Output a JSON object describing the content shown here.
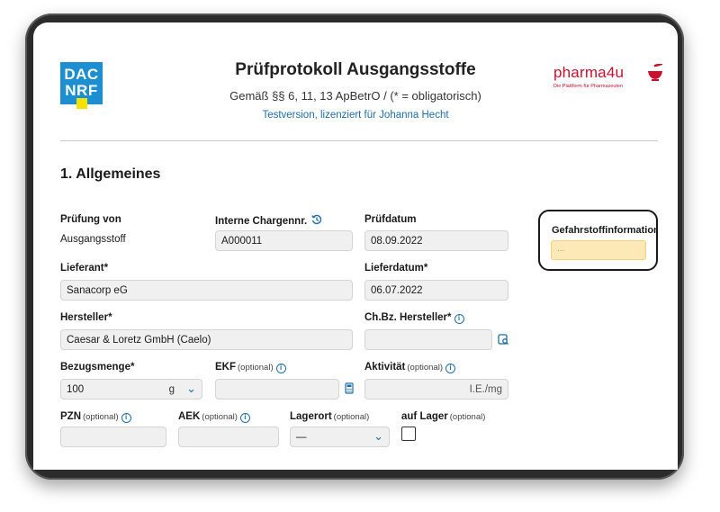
{
  "header": {
    "logo_left_line1": "DAC",
    "logo_left_line2": "NRF",
    "title": "Prüfprotokoll Ausgangsstoffe",
    "subtitle": "Gemäß §§ 6, 11, 13 ApBetrO / (* = obligatorisch)",
    "license": "Testversion, lizenziert für Johanna Hecht",
    "logo_right": "pharma4u",
    "logo_right_tagline": "Die Plattform für Pharmazeuten"
  },
  "section": {
    "title": "1. Allgemeines"
  },
  "form": {
    "pruefung_von": {
      "label": "Prüfung von",
      "value": "Ausgangsstoff"
    },
    "chargennr": {
      "label": "Interne Chargennr.",
      "value": "A000011",
      "icon": "history-icon"
    },
    "pruefdatum": {
      "label": "Prüfdatum",
      "value": "08.09.2022"
    },
    "lieferant": {
      "label": "Lieferant",
      "mark": "*",
      "value": "Sanacorp eG"
    },
    "lieferdatum": {
      "label": "Lieferdatum",
      "mark": "*",
      "value": "06.07.2022"
    },
    "hersteller": {
      "label": "Hersteller",
      "mark": "*",
      "value": "Caesar & Loretz GmbH (Caelo)"
    },
    "chbz_hersteller": {
      "label": "Ch.Bz. Hersteller",
      "mark": "*",
      "value": ""
    },
    "bezugsmenge": {
      "label": "Bezugsmenge",
      "mark": "*",
      "value": "100",
      "unit": "g"
    },
    "ekf": {
      "label": "EKF",
      "optional": "(optional)",
      "value": ""
    },
    "aktivitaet": {
      "label": "Aktivität",
      "optional": "(optional)",
      "value": "I.E./mg"
    },
    "pzn": {
      "label": "PZN",
      "optional": "(optional)",
      "value": ""
    },
    "aek": {
      "label": "AEK",
      "optional": "(optional)",
      "value": ""
    },
    "lagerort": {
      "label": "Lagerort",
      "optional": "(optional)",
      "value": "—"
    },
    "auf_lager": {
      "label": "auf Lager",
      "optional": "(optional)",
      "checked": false
    }
  },
  "gefahrstoff": {
    "label": "Gefahrstoffinformation",
    "value": "..."
  },
  "colors": {
    "accent": "#1f6fa8",
    "brand_red": "#c8102e",
    "dac_blue": "#1d8fd0",
    "dac_yellow": "#f4e200",
    "warn_field": "#fde9b5"
  }
}
